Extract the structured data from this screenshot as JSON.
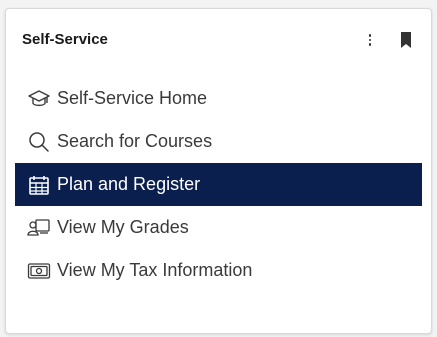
{
  "card": {
    "title": "Self-Service",
    "header_actions": {
      "more_icon": "kebab-vertical-icon",
      "bookmark_icon": "bookmark-icon"
    }
  },
  "menu": {
    "items": [
      {
        "label": "Self-Service Home",
        "icon": "graduation-cap-icon",
        "active": false
      },
      {
        "label": "Search for Courses",
        "icon": "search-icon",
        "active": false
      },
      {
        "label": "Plan and Register",
        "icon": "calendar-icon",
        "active": true
      },
      {
        "label": "View My Grades",
        "icon": "grades-icon",
        "active": false
      },
      {
        "label": "View My Tax Information",
        "icon": "tax-document-icon",
        "active": false
      }
    ]
  },
  "colors": {
    "active_background": "#0a1f4e",
    "active_text": "#ffffff",
    "text": "#3a3a3a",
    "card_background": "#ffffff"
  }
}
